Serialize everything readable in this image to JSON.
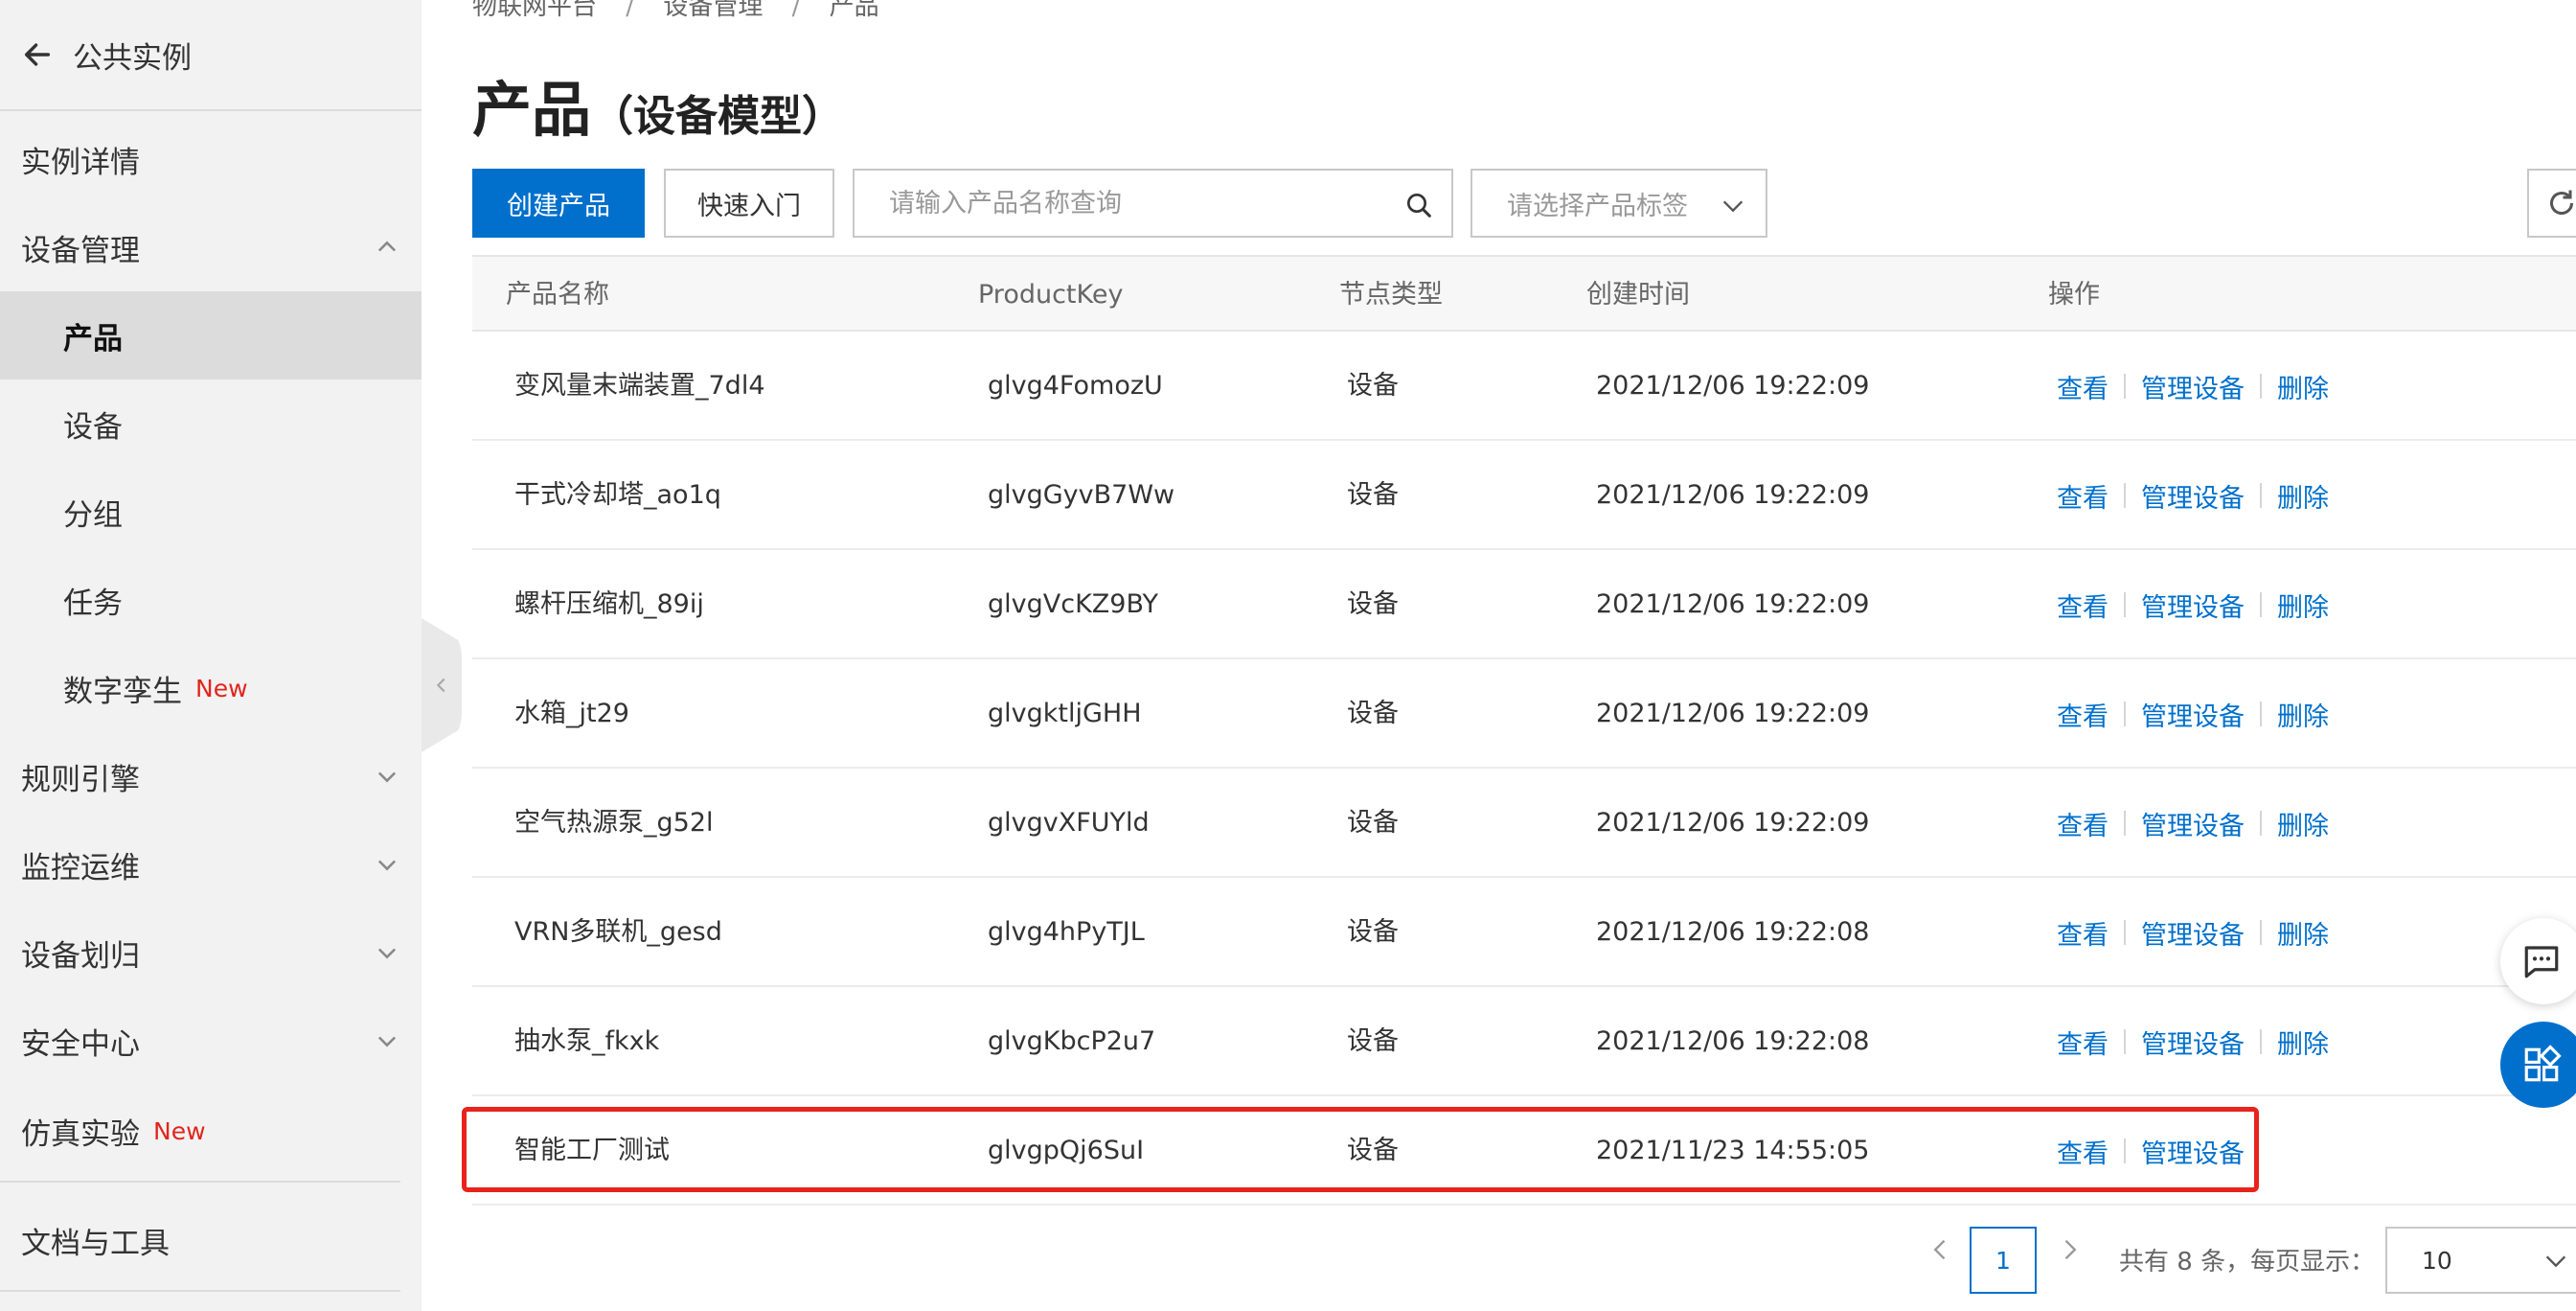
{
  "sidebar": {
    "back_label": "公共实例",
    "items": [
      {
        "label": "实例详情",
        "new": ""
      },
      {
        "label": "设备管理",
        "new": ""
      },
      {
        "label": "产品",
        "new": ""
      },
      {
        "label": "设备",
        "new": ""
      },
      {
        "label": "分组",
        "new": ""
      },
      {
        "label": "任务",
        "new": ""
      },
      {
        "label": "数字孪生",
        "new": "New"
      },
      {
        "label": "规则引擎",
        "new": ""
      },
      {
        "label": "监控运维",
        "new": ""
      },
      {
        "label": "设备划归",
        "new": ""
      },
      {
        "label": "安全中心",
        "new": ""
      },
      {
        "label": "仿真实验",
        "new": "New"
      },
      {
        "label": "文档与工具",
        "new": ""
      }
    ],
    "active_item": "产品"
  },
  "breadcrumb": [
    "物联网平台",
    "设备管理",
    "产品"
  ],
  "breadcrumb_sep": "/",
  "page": {
    "title": "产品",
    "subtitle": "（设备模型）"
  },
  "toolbar": {
    "create_label": "创建产品",
    "quickstart_label": "快速入门",
    "search_placeholder": "请输入产品名称查询",
    "tag_placeholder": "请选择产品标签"
  },
  "table": {
    "columns": [
      "产品名称",
      "ProductKey",
      "节点类型",
      "创建时间",
      "操作"
    ],
    "rows": [
      {
        "name": "变风量末端装置_7dl4",
        "key": "glvg4FomozU",
        "type": "设备",
        "created": "2021/12/06 19:22:09",
        "ops": [
          "查看",
          "管理设备",
          "删除"
        ]
      },
      {
        "name": "干式冷却塔_ao1q",
        "key": "glvgGyvB7Ww",
        "type": "设备",
        "created": "2021/12/06 19:22:09",
        "ops": [
          "查看",
          "管理设备",
          "删除"
        ]
      },
      {
        "name": "螺杆压缩机_89ij",
        "key": "glvgVcKZ9BY",
        "type": "设备",
        "created": "2021/12/06 19:22:09",
        "ops": [
          "查看",
          "管理设备",
          "删除"
        ]
      },
      {
        "name": "水箱_jt29",
        "key": "glvgktljGHH",
        "type": "设备",
        "created": "2021/12/06 19:22:09",
        "ops": [
          "查看",
          "管理设备",
          "删除"
        ]
      },
      {
        "name": "空气热源泵_g52l",
        "key": "glvgvXFUYld",
        "type": "设备",
        "created": "2021/12/06 19:22:09",
        "ops": [
          "查看",
          "管理设备",
          "删除"
        ]
      },
      {
        "name": "VRN多联机_gesd",
        "key": "glvg4hPyTJL",
        "type": "设备",
        "created": "2021/12/06 19:22:08",
        "ops": [
          "查看",
          "管理设备",
          "删除"
        ]
      },
      {
        "name": "抽水泵_fkxk",
        "key": "glvgKbcP2u7",
        "type": "设备",
        "created": "2021/12/06 19:22:08",
        "ops": [
          "查看",
          "管理设备",
          "删除"
        ]
      },
      {
        "name": "智能工厂测试",
        "key": "glvgpQj6SuI",
        "type": "设备",
        "created": "2021/11/23 14:55:05",
        "ops": [
          "查看",
          "管理设备"
        ]
      }
    ]
  },
  "pagination": {
    "current_page": "1",
    "total_text": "共有 8 条，每页显示：",
    "page_size": "10"
  },
  "colors": {
    "primary": "#0070cc",
    "highlight": "#e8231b",
    "new_badge": "#e1251b"
  },
  "icons": [
    "arrow-left-icon",
    "chevron-up-icon",
    "chevron-down-icon",
    "chevron-left-icon",
    "search-icon",
    "refresh-icon",
    "chevron-right-icon",
    "chat-icon",
    "apps-icon"
  ]
}
